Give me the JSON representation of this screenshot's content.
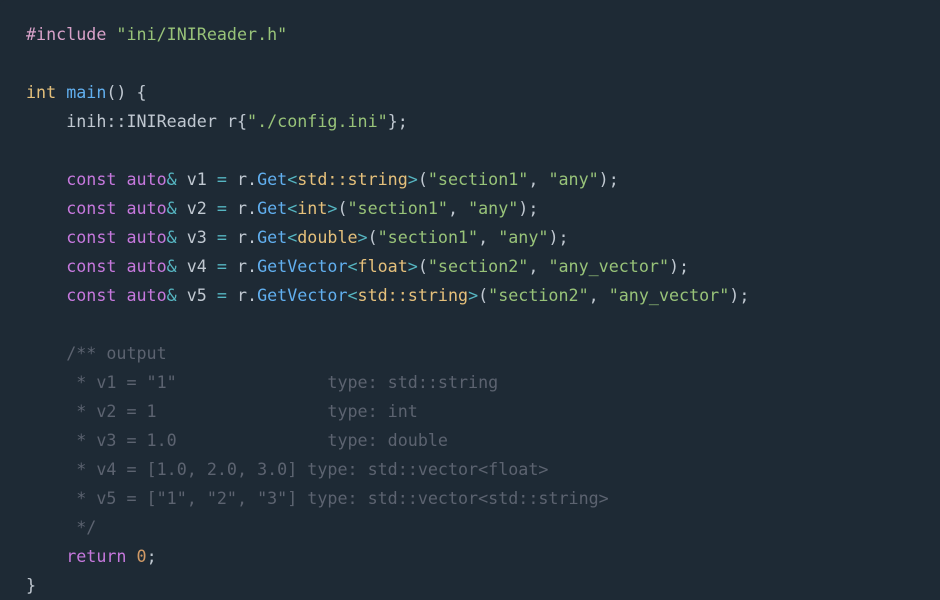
{
  "code": {
    "include_path": "\"ini/INIReader.h\"",
    "main_sig_int": "int",
    "main_sig_name": "main",
    "reader_ns": "inih::INIReader",
    "reader_var": "r",
    "reader_arg": "\"./config.ini\"",
    "const": "const",
    "auto": "auto",
    "amp": "&",
    "eq": "=",
    "get": "Get",
    "getvec": "GetVector",
    "lt": "<",
    "gt": ">",
    "return_kw": "return",
    "zero": "0",
    "vars": {
      "v1": {
        "name": "v1",
        "tpl": "std::string",
        "arg1": "\"section1\"",
        "arg2": "\"any\""
      },
      "v2": {
        "name": "v2",
        "tpl": "int",
        "arg1": "\"section1\"",
        "arg2": "\"any\""
      },
      "v3": {
        "name": "v3",
        "tpl": "double",
        "arg1": "\"section1\"",
        "arg2": "\"any\""
      },
      "v4": {
        "name": "v4",
        "tpl": "float",
        "arg1": "\"section2\"",
        "arg2": "\"any_vector\""
      },
      "v5": {
        "name": "v5",
        "tpl": "std::string",
        "arg1": "\"section2\"",
        "arg2": "\"any_vector\""
      }
    },
    "comment": {
      "l0": "/** output",
      "l1": " * v1 = \"1\"               type: std::string",
      "l2": " * v2 = 1                 type: int",
      "l3": " * v3 = 1.0               type: double",
      "l4": " * v4 = [1.0, 2.0, 3.0] type: std::vector<float>",
      "l5": " * v5 = [\"1\", \"2\", \"3\"] type: std::vector<std::string>",
      "l6": " */"
    }
  }
}
